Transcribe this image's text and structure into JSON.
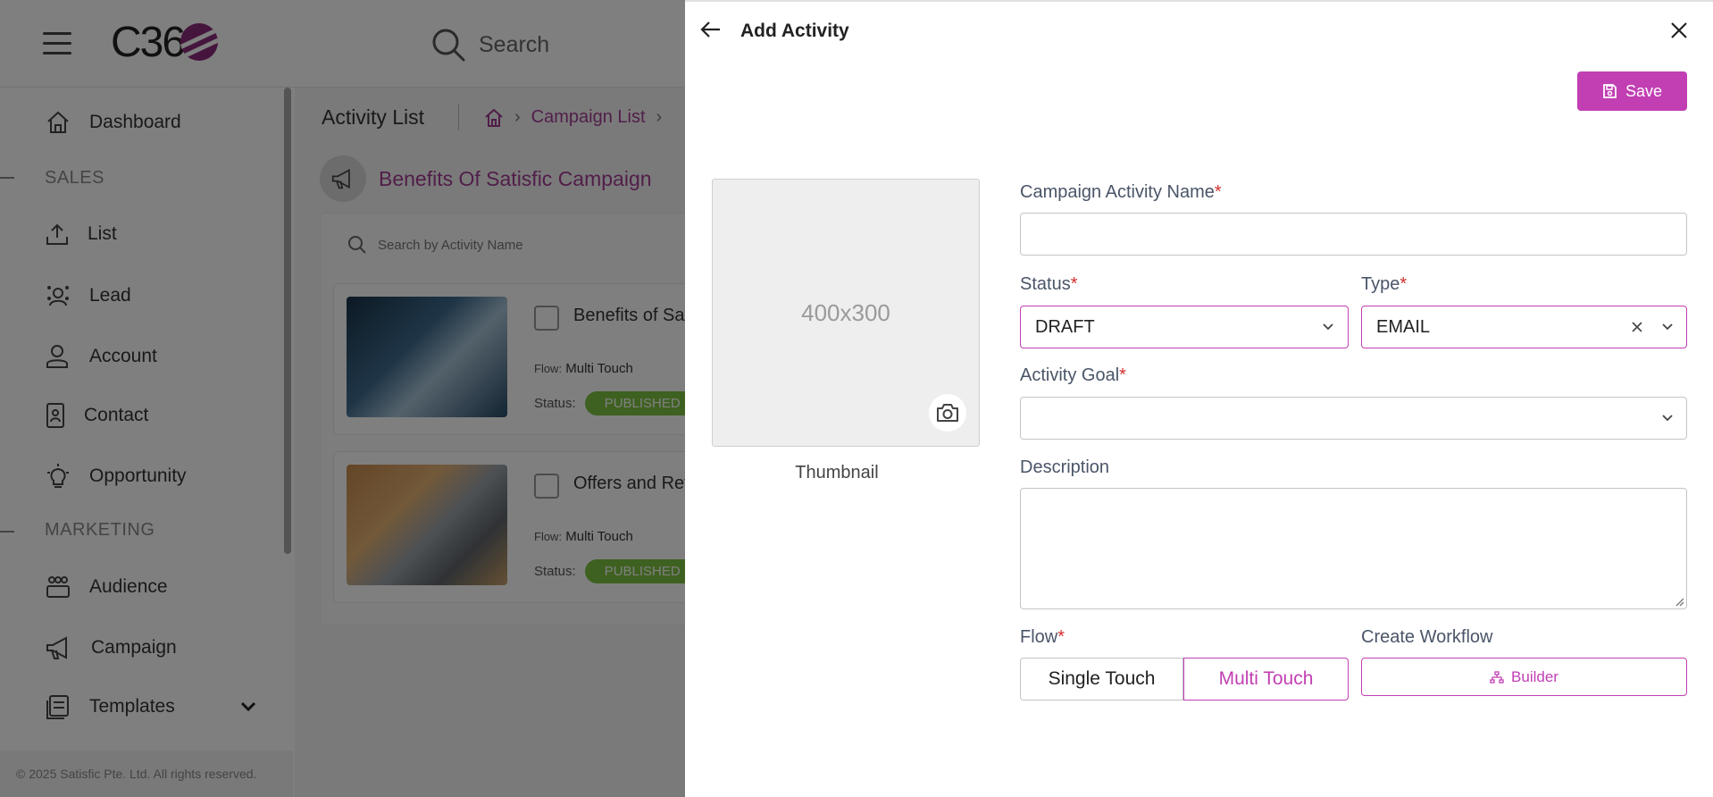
{
  "app": {
    "logo_text": "C36",
    "search_label": "Search",
    "footer": "© 2025 Satisfic Pte. Ltd. All rights reserved."
  },
  "sidebar": {
    "dashboard": "Dashboard",
    "sales_section": "SALES",
    "list": "List",
    "lead": "Lead",
    "account": "Account",
    "contact": "Contact",
    "opportunity": "Opportunity",
    "marketing_section": "MARKETING",
    "audience": "Audience",
    "campaign": "Campaign",
    "templates": "Templates"
  },
  "content": {
    "page_title": "Activity List",
    "breadcrumb_campaign_list": "Campaign List",
    "campaign_name": "Benefits Of Satisfic Campaign",
    "search_placeholder": "Search by Activity Name",
    "flow_key": "Flow:",
    "status_key": "Status:",
    "cards": [
      {
        "title": "Benefits of Sat",
        "flow": "Multi Touch",
        "status": "PUBLISHED"
      },
      {
        "title": "Offers and Rev",
        "flow": "Multi Touch",
        "status": "PUBLISHED"
      }
    ]
  },
  "drawer": {
    "title": "Add Activity",
    "save_label": "Save",
    "thumbnail_size": "400x300",
    "thumbnail_label": "Thumbnail",
    "name_label": "Campaign Activity Name",
    "name_value": "",
    "status_label": "Status",
    "status_value": "DRAFT",
    "type_label": "Type",
    "type_value": "EMAIL",
    "goal_label": "Activity Goal",
    "goal_value": "",
    "description_label": "Description",
    "description_value": "",
    "flow_label": "Flow",
    "flow_options": [
      "Single Touch",
      "Multi Touch"
    ],
    "flow_selected": "Multi Touch",
    "workflow_label": "Create Workflow",
    "builder_label": "Builder",
    "required_mark": "*"
  },
  "colors": {
    "accent": "#c13fb3",
    "breadcrumb": "#a33c95",
    "published": "#7cc242",
    "required": "#d32f2f"
  },
  "icons": [
    "hamburger-icon",
    "search-icon",
    "home-icon",
    "megaphone-icon",
    "arrow-left-icon",
    "close-icon",
    "save-icon",
    "camera-icon",
    "chevron-down-icon",
    "clear-icon",
    "sitemap-icon"
  ]
}
